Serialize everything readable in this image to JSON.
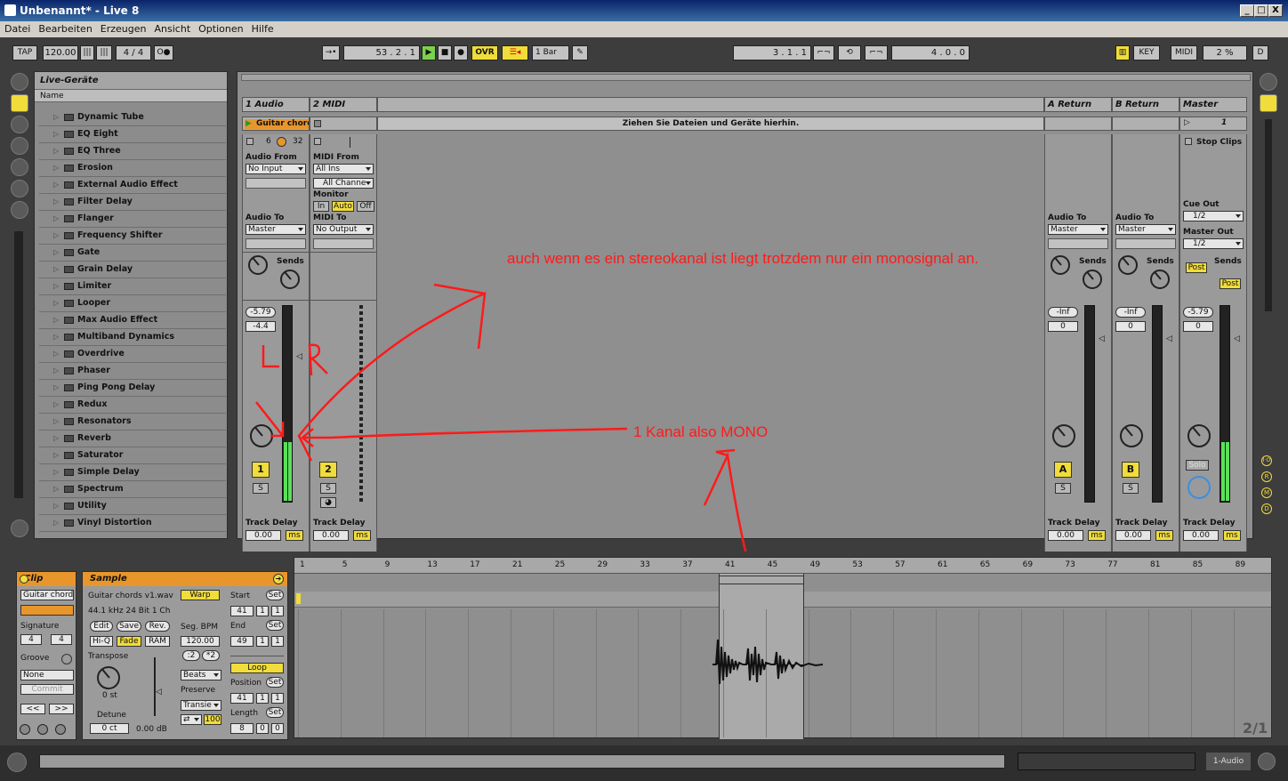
{
  "window": {
    "title": "Unbenannt* - Live 8",
    "min": "_",
    "max": "□",
    "close": "X"
  },
  "menu": [
    "Datei",
    "Bearbeiten",
    "Erzeugen",
    "Ansicht",
    "Optionen",
    "Hilfe"
  ],
  "transport": {
    "tap": "TAP",
    "bpm": "120.00",
    "sig": "4 / 4",
    "metro": "O●",
    "position": "53 .  2 .  1",
    "ovr": "OVR",
    "quantize": "1 Bar",
    "loop_start": "3 .  1 .  1",
    "loop_len": "4 .  0 .  0",
    "key": "KEY",
    "midi": "MIDI",
    "cpu": "2 %",
    "d": "D"
  },
  "browser": {
    "title": "Live-Geräte",
    "col": "Name",
    "items": [
      "Dynamic Tube",
      "EQ Eight",
      "EQ Three",
      "Erosion",
      "External Audio Effect",
      "Filter Delay",
      "Flanger",
      "Frequency Shifter",
      "Gate",
      "Grain Delay",
      "Limiter",
      "Looper",
      "Max Audio Effect",
      "Multiband Dynamics",
      "Overdrive",
      "Phaser",
      "Ping Pong Delay",
      "Redux",
      "Resonators",
      "Reverb",
      "Saturator",
      "Simple Delay",
      "Spectrum",
      "Utility",
      "Vinyl Distortion"
    ]
  },
  "tracks": {
    "t1": {
      "name": "1 Audio",
      "clip": "Guitar chord",
      "from": "Audio From",
      "from_val": "No Input",
      "to": "Audio To",
      "to_val": "Master",
      "vol": "-5.79",
      "pan": "-4.4",
      "num": "1",
      "s": "S",
      "delay": "Track Delay",
      "delay_val": "0.00",
      "ms": "ms",
      "n6": "6",
      "n32": "32"
    },
    "t2": {
      "name": "2 MIDI",
      "from": "MIDI From",
      "from_val": "All Ins",
      "ch": "All Channe",
      "monitor": "Monitor",
      "in": "In",
      "auto": "Auto",
      "off": "Off",
      "to": "MIDI To",
      "to_val": "No Output",
      "num": "2",
      "s": "S",
      "delay": "Track Delay",
      "delay_val": "0.00",
      "ms": "ms"
    },
    "drop": "Ziehen Sie Dateien und Geräte hierhin.",
    "sends": "Sends",
    "ra": {
      "name": "A Return",
      "to": "Audio To",
      "to_val": "Master",
      "vol": "-Inf",
      "pan": "0",
      "btn": "A",
      "s": "S",
      "delay": "Track Delay",
      "delay_val": "0.00",
      "ms": "ms"
    },
    "rb": {
      "name": "B Return",
      "to": "Audio To",
      "to_val": "Master",
      "vol": "-Inf",
      "pan": "0",
      "btn": "B",
      "s": "S",
      "delay": "Track Delay",
      "delay_val": "0.00",
      "ms": "ms"
    },
    "master": {
      "name": "Master",
      "scene": "1",
      "stop": "Stop Clips",
      "cue": "Cue Out",
      "cue_val": "1/2",
      "mout": "Master Out",
      "mout_val": "1/2",
      "post": "Post",
      "vol": "-5.79",
      "pan": "0",
      "solo": "Solo",
      "delay": "Track Delay",
      "delay_val": "0.00",
      "ms": "ms"
    }
  },
  "annotations": {
    "stereo": "auch wenn es ein stereokanal ist liegt trotzdem nur ein monosignal an.",
    "lr": "L R",
    "mono": "1 Kanal also MONO"
  },
  "clip": {
    "title": "Clip",
    "name": "Guitar chords",
    "signature": "Signature",
    "sig_n": "4",
    "sig_d": "4",
    "groove": "Groove",
    "groove_val": "None",
    "commit": "Commit",
    "prev": "<<",
    "next": ">>"
  },
  "sample": {
    "title": "Sample",
    "file": "Guitar chords v1.wav",
    "info": "44.1 kHz 24 Bit 1 Ch",
    "edit": "Edit",
    "save": "Save",
    "rev": "Rev.",
    "hiq": "Hi-Q",
    "fade": "Fade",
    "ram": "RAM",
    "transpose": "Transpose",
    "st": "0 st",
    "detune": "Detune",
    "ct": "0 ct",
    "db": "0.00 dB",
    "warp": "Warp",
    "segbpm": "Seg. BPM",
    "bpm": "120.00",
    "half": ":2",
    "dbl": "*2",
    "beats": "Beats",
    "preserve": "Preserve",
    "transie": "Transie",
    "hundred": "100",
    "start": "Start",
    "set": "Set",
    "end": "End",
    "loop": "Loop",
    "position": "Position",
    "length": "Length",
    "start_v": [
      "41",
      "1",
      "1"
    ],
    "end_v": [
      "49",
      "1",
      "1"
    ],
    "pos_v": [
      "41",
      "1",
      "1"
    ],
    "len_v": [
      "8",
      "0",
      "0"
    ]
  },
  "arrange": {
    "ruler": [
      "1",
      "5",
      "9",
      "13",
      "17",
      "21",
      "25",
      "29",
      "33",
      "37",
      "41",
      "45",
      "49",
      "53",
      "57",
      "61",
      "65",
      "69",
      "73",
      "77",
      "81",
      "85",
      "89"
    ],
    "zoom": "2/1"
  },
  "status": {
    "track": "1-Audio"
  }
}
